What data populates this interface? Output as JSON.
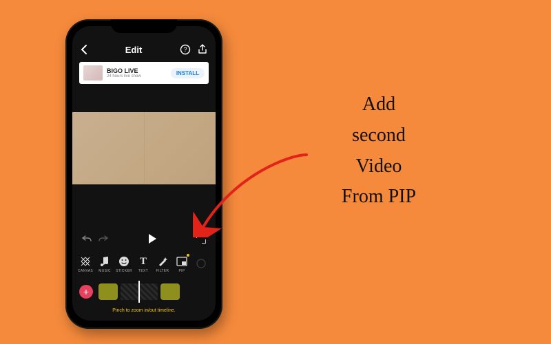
{
  "annotation": {
    "line1": "Add",
    "line2": "second",
    "line3": "Video",
    "line4": "From PIP"
  },
  "header": {
    "title": "Edit"
  },
  "ad": {
    "title": "BIGO LIVE",
    "subtitle": "24 hours live show",
    "cta": "INSTALL"
  },
  "tools": [
    {
      "id": "canvas",
      "label": "CANVAS",
      "icon": "grid"
    },
    {
      "id": "music",
      "label": "MUSIC",
      "icon": "note"
    },
    {
      "id": "sticker",
      "label": "STICKER",
      "icon": "smile"
    },
    {
      "id": "text",
      "label": "TEXT",
      "icon": "T"
    },
    {
      "id": "filter",
      "label": "FILTER",
      "icon": "wand"
    },
    {
      "id": "pip",
      "label": "PIP",
      "icon": "pip",
      "badge": true
    },
    {
      "id": "more",
      "label": "",
      "icon": "more"
    }
  ],
  "timeline": {
    "add": "+",
    "hint": "Pinch to zoom in/out timeline."
  },
  "colors": {
    "bg": "#f58a3c",
    "accent_red": "#e8415f",
    "accent_yellow": "#f5c518",
    "arrow": "#e2231a"
  }
}
